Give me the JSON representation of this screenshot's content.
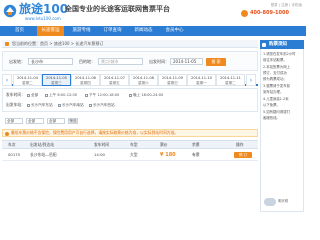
{
  "header": {
    "logo_text": "旅途100",
    "logo_url": "www.lvtu100.com",
    "slogan": "全国专业的长途客运联网售票平台",
    "top_links": "登录 | 注册 | 手机版",
    "phone": "400-809-1000"
  },
  "nav": {
    "items": [
      "首页",
      "长途客运",
      "旅游专线",
      "订单查询",
      "新闻动态",
      "会员中心"
    ],
    "active_index": 1
  },
  "breadcrumb": "您当前的位置：首页 > 旅途100 > 长途汽车票预订",
  "search": {
    "from_label": "出发地：",
    "from_value": "长沙市",
    "to_label": "目的地：",
    "to_placeholder": "景点/城市",
    "date_label": "出发时间：",
    "date_value": "2014-11-05",
    "button": "搜 索"
  },
  "dates": {
    "prev": "‹",
    "next": "›",
    "tabs": [
      {
        "date": "2014-11-04",
        "weekday": "星期二"
      },
      {
        "date": "2014-11-05",
        "weekday": "星期三"
      },
      {
        "date": "2014-11-06",
        "weekday": "星期四"
      },
      {
        "date": "2014-11-07",
        "weekday": "星期五"
      },
      {
        "date": "2014-11-08",
        "weekday": "星期六"
      },
      {
        "date": "2014-11-09",
        "weekday": "星期日"
      },
      {
        "date": "2014-11-10",
        "weekday": "星期一"
      },
      {
        "date": "2014-11-11",
        "weekday": "星期二"
      }
    ],
    "active_index": 1
  },
  "filters": {
    "time_label": "发车时间：",
    "time_options": [
      "全部",
      "上午 6:00-12:00",
      "下午 12:00-18:00",
      "晚上 18:00-24:00"
    ],
    "station_label": "出发车站：",
    "station_options": [
      "长沙汽车东站",
      "长沙汽车南站",
      "长沙汽车西站"
    ]
  },
  "sort": {
    "select_1": "全部",
    "select_2": "全部",
    "select_3": "全部",
    "button": "筛选"
  },
  "notice": "最低车票价格不含保险，保险费用用户可自行选择，请按实际取票价格为准，以实际到站时间为准。",
  "table": {
    "headers": [
      "车次",
      "出发站/到达站",
      "发车时间",
      "车型",
      "票价",
      "余票",
      "操作"
    ],
    "rows": [
      {
        "code": "00175",
        "stations": "长沙东站—岳阳",
        "time": "14:00",
        "type": "大型",
        "price": "¥ 180",
        "seats": "有票",
        "action": "预 订"
      }
    ]
  },
  "side": {
    "title": "购票须知",
    "items": [
      "1.请您在发车前2小时",
      "  前往车站取票。",
      "2.本站售票为网上",
      "  预订，支付成功",
      "  即为购票成功。",
      "3.退票请于发车前",
      "  到车站办理。",
      "4.儿童身高1.2米",
      "  以下免票。",
      "5.如有疑问请拨打",
      "  客服热线。"
    ],
    "weather": "明天晴"
  },
  "colors": {
    "primary": "#2b7cd3",
    "accent": "#f08a1e"
  }
}
